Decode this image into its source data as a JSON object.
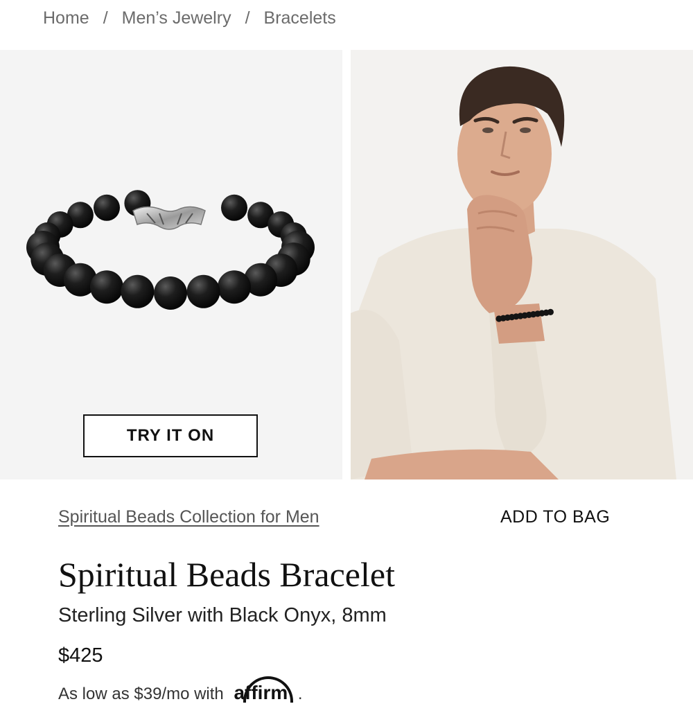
{
  "breadcrumb": {
    "items": [
      "Home",
      "Men’s Jewelry",
      "Bracelets"
    ],
    "separator": "/"
  },
  "gallery": {
    "product_image": "bracelet-product-image",
    "model_image": "model-wearing-bracelet-image",
    "try_it_on_label": "TRY IT ON"
  },
  "product": {
    "collection_link": "Spiritual Beads Collection for Men",
    "add_to_bag_label": "ADD TO BAG",
    "title": "Spiritual Beads Bracelet",
    "subtitle": "Sterling Silver with Black Onyx, 8mm",
    "price": "$425",
    "financing_prefix": "As low as $39/mo with",
    "financing_brand": "affirm",
    "financing_suffix": "."
  },
  "colors": {
    "panel_bg": "#f4f4f4",
    "sweater": "#ece6dc",
    "bead": "#141414"
  }
}
